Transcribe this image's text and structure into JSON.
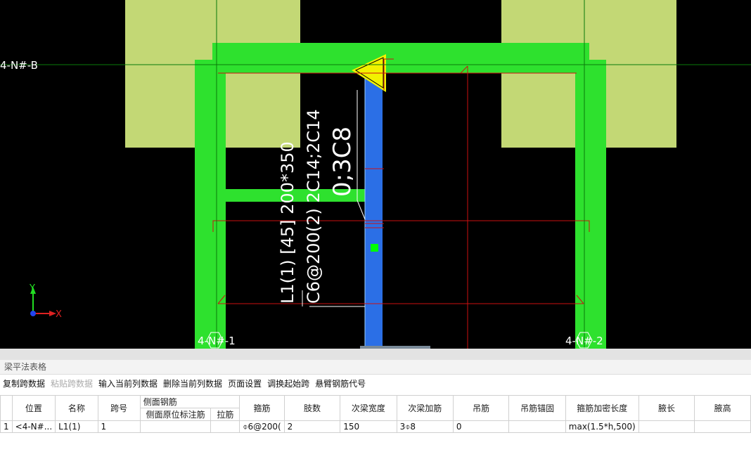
{
  "canvas": {
    "axis_labels": {
      "row_b": "4-N#-B",
      "col_1": "4-N#-1",
      "col_2": "4-N#-2"
    },
    "beam_annotation": {
      "line1": "L1(1) [45] 200*350",
      "line2": "C6@200(2) 2C14;2C14",
      "line3": "0;3C8"
    },
    "ucs": {
      "x_label": "X",
      "y_label": "Y"
    },
    "colors": {
      "background": "#000000",
      "column": "#c3d875",
      "beam": "#2ee12e",
      "selected_beam": "#2b6fe6",
      "outline": "#cc1111",
      "arrow": "#f2f200"
    }
  },
  "panel": {
    "title": "梁平法表格",
    "toolbar": [
      {
        "label": "复制跨数据",
        "enabled": true
      },
      {
        "label": "粘贴跨数据",
        "enabled": false
      },
      {
        "label": "输入当前列数据",
        "enabled": true
      },
      {
        "label": "删除当前列数据",
        "enabled": true
      },
      {
        "label": "页面设置",
        "enabled": true
      },
      {
        "label": "调换起始跨",
        "enabled": true
      },
      {
        "label": "悬臂钢筋代号",
        "enabled": true
      }
    ],
    "table": {
      "group_header": "侧面钢筋",
      "headers": {
        "rownum": "",
        "position": "位置",
        "name": "名称",
        "span": "跨号",
        "side_note": "侧面原位标注筋",
        "tie": "拉筋",
        "stirrup": "箍筋",
        "legs": "肢数",
        "sec_width": "次梁宽度",
        "sec_add": "次梁加筋",
        "hanger": "吊筋",
        "hanger_anchor": "吊筋锚固",
        "dense_len": "箍筋加密长度",
        "haunch_len": "腋长",
        "haunch_h": "腋高"
      },
      "rows": [
        {
          "rownum": "1",
          "position": "<4-N#...",
          "name": "L1(1)",
          "span": "1",
          "side_note": "",
          "tie": "",
          "stirrup": "⌽6@200(",
          "legs": "2",
          "sec_width": "150",
          "sec_add": "3⌽8",
          "hanger": "0",
          "hanger_anchor": "",
          "dense_len": "max(1.5*h,500)",
          "haunch_len": "",
          "haunch_h": ""
        }
      ]
    }
  }
}
